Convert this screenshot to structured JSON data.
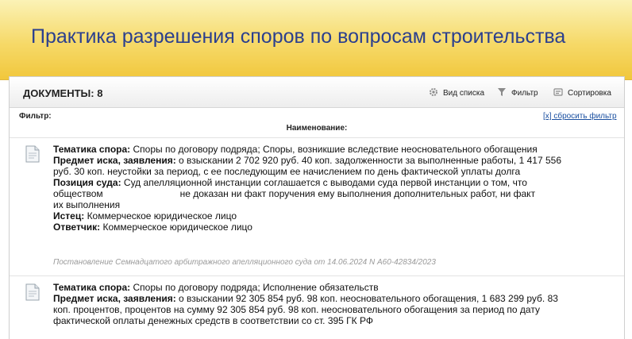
{
  "banner": {
    "title": "Практика разрешения споров по вопросам строительства"
  },
  "header": {
    "documents_label": "ДОКУМЕНТЫ: 8",
    "view_list": "Вид списка",
    "filter": "Фильтр",
    "sort": "Сортировка"
  },
  "filter": {
    "label": "Фильтр:",
    "reset": "[x] сбросить фильтр",
    "column": "Наименование:"
  },
  "documents": [
    {
      "topic_label": "Тематика спора:",
      "topic": " Споры по договору подряда; Споры, возникшие вследствие неосновательного обогащения",
      "claim_label": "Предмет иска, заявления:",
      "claim": " о взыскании 2 702 920 руб. 40 коп. задолженности за выполненные работы, 1 417 556 руб. 30 коп. неустойки за период, с ее последующим ее начислением по день фактической уплаты долга",
      "position_label": "Позиция суда:",
      "position_line1": " Суд апелляционной инстанции соглашается с выводами суда первой инстанции о том, что",
      "position_line2_a": "обществом",
      "position_line2_b": "не доказан ни факт поручения ему выполнения дополнительных работ, ни факт",
      "position_line3": "их выполнения",
      "plaintiff_label": "Истец:",
      "plaintiff": " Коммерческое юридическое лицо",
      "defendant_label": "Ответчик:",
      "defendant": " Коммерческое юридическое лицо",
      "citation": "Постановление Семнадцатого арбитражного апелляционного суда от 14.06.2024 N А60-42834/2023"
    },
    {
      "topic_label": "Тематика спора:",
      "topic": " Споры по договору подряда; Исполнение обязательств",
      "claim_label": "Предмет иска, заявления:",
      "claim": " о взыскании 92 305 854 руб. 98 коп. неосновательного обогащения, 1 683 299 руб. 83 коп. процентов, процентов на сумму 92 305 854 руб. 98 коп. неосновательного обогащения за период по дату фактической оплаты денежных средств в соответствии со ст. 395 ГК РФ"
    }
  ]
}
